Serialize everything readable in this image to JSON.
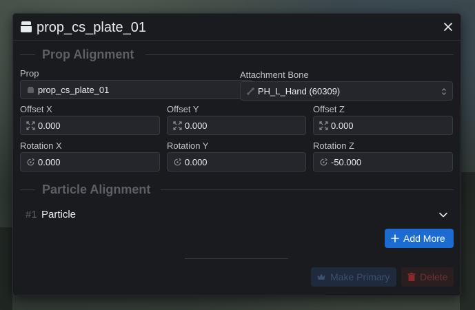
{
  "window": {
    "title": "prop_cs_plate_01"
  },
  "sections": {
    "prop_alignment": "Prop Alignment",
    "particle_alignment": "Particle Alignment"
  },
  "prop": {
    "label": "Prop",
    "value": "prop_cs_plate_01",
    "bone_label": "Attachment Bone",
    "bone_value": "PH_L_Hand (60309)"
  },
  "offset": {
    "x_label": "Offset X",
    "x": "0.000",
    "y_label": "Offset Y",
    "y": "0.000",
    "z_label": "Offset Z",
    "z": "0.000"
  },
  "rotation": {
    "x_label": "Rotation X",
    "x": "0.000",
    "y_label": "Rotation Y",
    "y": "0.000",
    "z_label": "Rotation Z",
    "z": "-50.000"
  },
  "particles": [
    {
      "index": "#1",
      "name": "Particle"
    }
  ],
  "buttons": {
    "add_more": "Add More",
    "make_primary": "Make Primary",
    "delete": "Delete"
  },
  "colors": {
    "accent": "#1c6bd1",
    "window_bg": "#1a1b1e",
    "input_bg": "#25262b",
    "delete": "#c92a2a"
  },
  "icons": {
    "title": "box-icon",
    "close": "close-icon",
    "prop": "box-icon",
    "bone": "bone-icon",
    "offset": "arrows-maximize-icon",
    "rotation": "rotate-icon",
    "expand": "chevron-down-icon",
    "add": "plus-icon",
    "primary": "crown-icon",
    "delete": "trash-icon"
  }
}
